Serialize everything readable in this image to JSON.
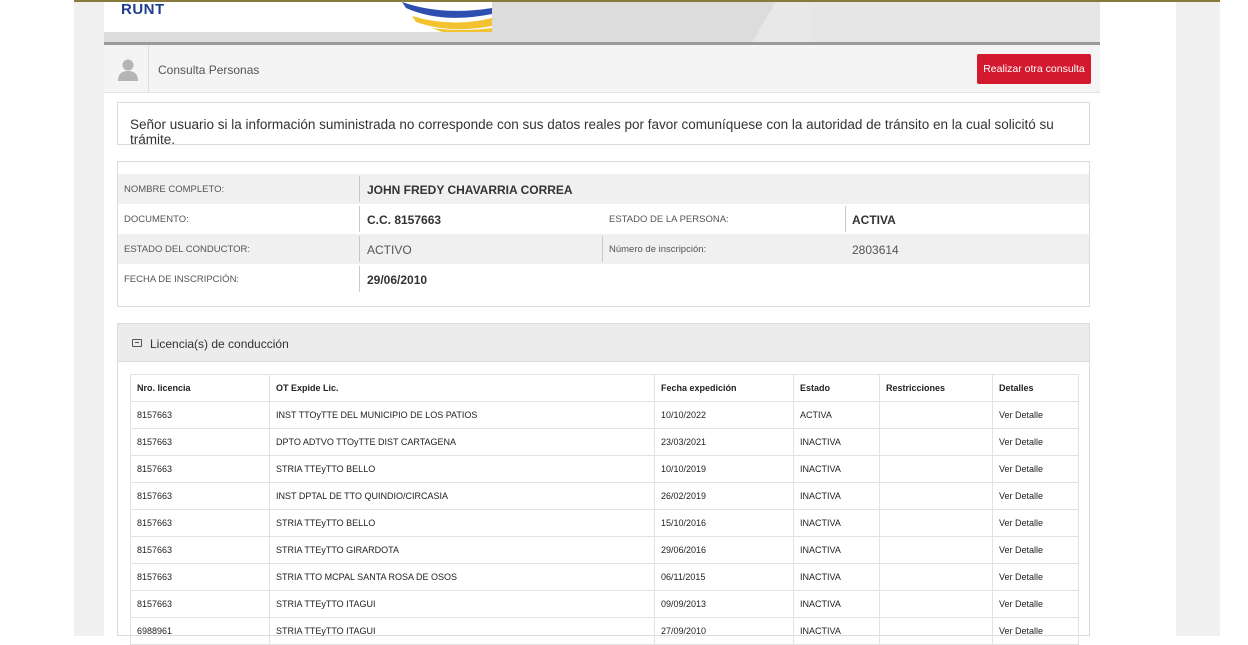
{
  "banner": {
    "logo_text": "RUNT"
  },
  "toolbar": {
    "title": "Consulta Personas",
    "button_label": "Realizar otra consulta"
  },
  "notice": {
    "text": "Señor usuario si la información suministrada no corresponde con sus datos reales por favor comuníquese con la autoridad de tránsito en la cual solicitó su trámite."
  },
  "person": {
    "nombre_label": "NOMBRE COMPLETO:",
    "nombre": "JOHN FREDY CHAVARRIA CORREA",
    "documento_label": "DOCUMENTO:",
    "documento": "C.C. 8157663",
    "estado_persona_label": "ESTADO DE LA PERSONA:",
    "estado_persona": "ACTIVA",
    "estado_conductor_label": "ESTADO DEL CONDUCTOR:",
    "estado_conductor": "ACTIVO",
    "inscripcion_label": "Número de inscripción:",
    "inscripcion": "2803614",
    "fecha_label": "FECHA DE INSCRIPCIÓN:",
    "fecha": "29/06/2010"
  },
  "licencias": {
    "title": "Licencia(s) de conducción",
    "columns": [
      "Nro. licencia",
      "OT Expide Lic.",
      "Fecha expedición",
      "Estado",
      "Restricciones",
      "Detalles"
    ],
    "rows": [
      [
        "8157663",
        "INST TTOyTTE DEL MUNICIPIO DE LOS PATIOS",
        "10/10/2022",
        "ACTIVA",
        "",
        "Ver Detalle"
      ],
      [
        "8157663",
        "DPTO ADTVO TTOyTTE DIST CARTAGENA",
        "23/03/2021",
        "INACTIVA",
        "",
        "Ver Detalle"
      ],
      [
        "8157663",
        "STRIA TTEyTTO BELLO",
        "10/10/2019",
        "INACTIVA",
        "",
        "Ver Detalle"
      ],
      [
        "8157663",
        "INST DPTAL DE TTO QUINDIO/CIRCASIA",
        "26/02/2019",
        "INACTIVA",
        "",
        "Ver Detalle"
      ],
      [
        "8157663",
        "STRIA TTEyTTO BELLO",
        "15/10/2016",
        "INACTIVA",
        "",
        "Ver Detalle"
      ],
      [
        "8157663",
        "STRIA TTEyTTO GIRARDOTA",
        "29/06/2016",
        "INACTIVA",
        "",
        "Ver Detalle"
      ],
      [
        "8157663",
        "STRIA TTO MCPAL SANTA ROSA DE OSOS",
        "06/11/2015",
        "INACTIVA",
        "",
        "Ver Detalle"
      ],
      [
        "8157663",
        "STRIA TTEyTTO ITAGUI",
        "09/09/2013",
        "INACTIVA",
        "",
        "Ver Detalle"
      ],
      [
        "6988961",
        "STRIA TTEyTTO ITAGUI",
        "27/09/2010",
        "INACTIVA",
        "",
        "Ver Detalle"
      ]
    ]
  }
}
